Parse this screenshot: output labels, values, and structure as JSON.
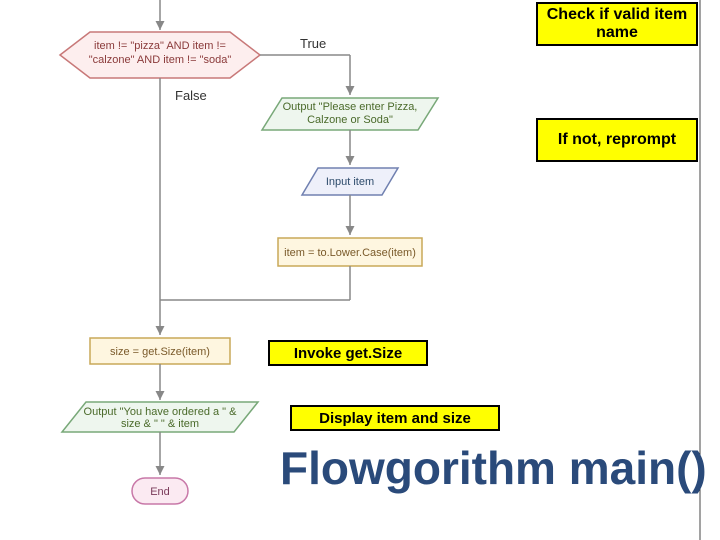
{
  "diagram": {
    "decision": "item != \"pizza\" AND item != \"calzone\" AND item != \"soda\"",
    "true_label": "True",
    "false_label": "False",
    "output_prompt": "Output \"Please enter Pizza, Calzone or Soda\"",
    "input_item": "Input item",
    "lowercase": "item = to.Lower.Case(item)",
    "assign_size": "size = get.Size(item)",
    "output_order": "Output \"You have ordered a \" & size & \" \" & item",
    "end": "End"
  },
  "callouts": {
    "check": "Check if valid item name",
    "reprompt": "If not, reprompt",
    "invoke": "Invoke get.Size",
    "display": "Display item and size"
  },
  "title": "Flowgorithm main()",
  "colors": {
    "decision_fill": "#fdeeee",
    "decision_stroke": "#c87878",
    "output_fill": "#eef6ee",
    "output_stroke": "#78a878",
    "input_fill": "#eef0fa",
    "input_stroke": "#7080b0",
    "process_fill": "#fef6e0",
    "process_stroke": "#c8a858",
    "end_fill": "#fbeaf2",
    "end_stroke": "#c878a8",
    "arrow": "#888888"
  }
}
